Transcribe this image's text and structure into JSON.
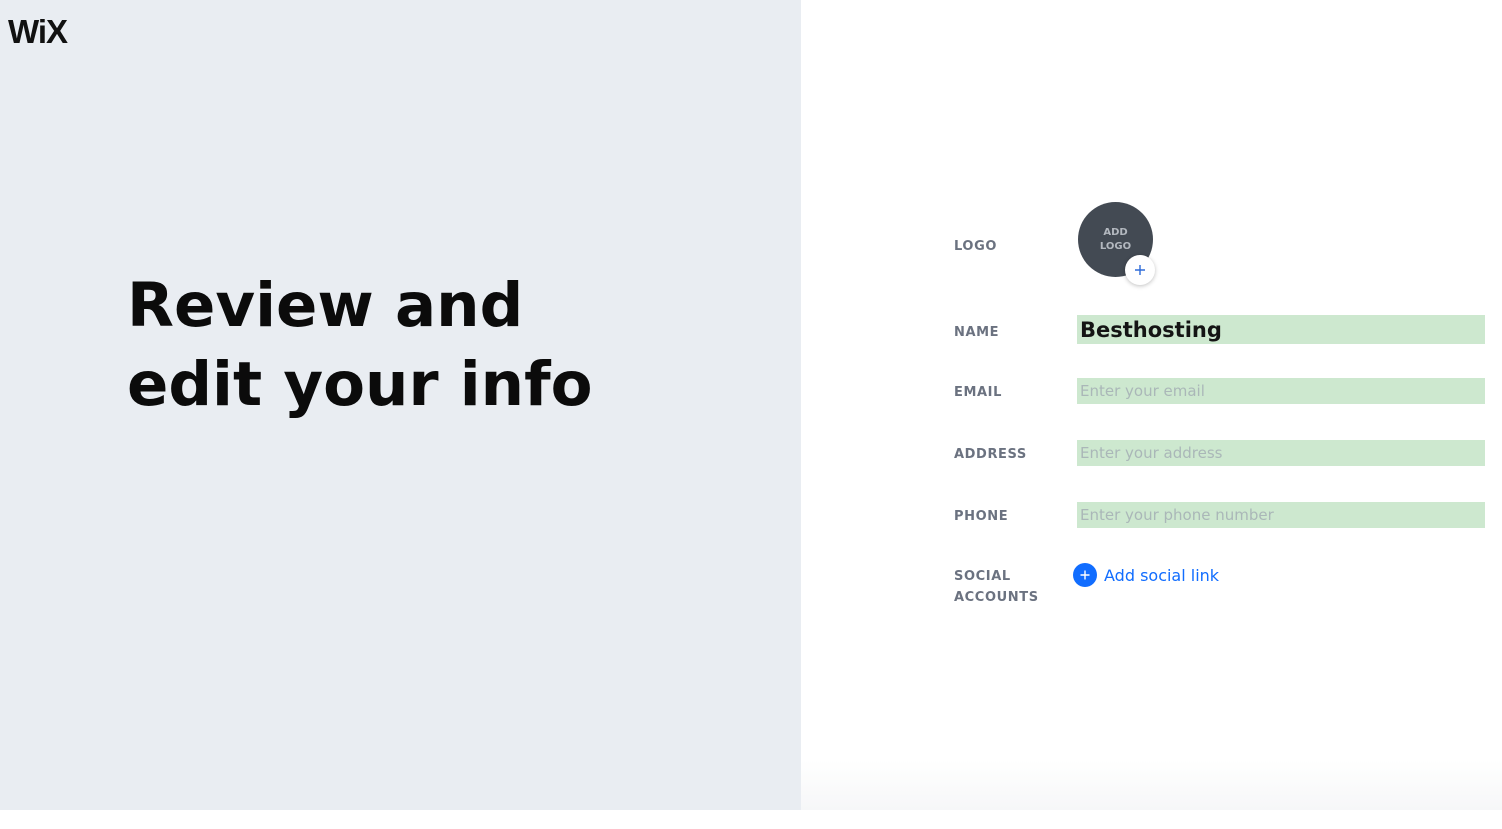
{
  "brand": {
    "logo_text": "WiX"
  },
  "hero": {
    "title_line1": "Review and",
    "title_line2": "edit your info"
  },
  "form": {
    "logo": {
      "label": "LOGO",
      "button_text": "ADD LOGO",
      "plus_icon": "plus-icon"
    },
    "name": {
      "label": "NAME",
      "value": "Besthosting"
    },
    "email": {
      "label": "EMAIL",
      "placeholder": "Enter your email"
    },
    "address": {
      "label": "ADDRESS",
      "placeholder": "Enter your address"
    },
    "phone": {
      "label": "PHONE",
      "placeholder": "Enter your phone number"
    },
    "social": {
      "label": "SOCIAL ACCOUNTS",
      "add_link_label": "Add social link",
      "add_icon": "plus-circle-icon"
    }
  },
  "colors": {
    "left_panel_bg": "#e9edf2",
    "input_highlight": "#cde8cf",
    "accent_blue": "#116dff",
    "logo_circle": "#434a53",
    "label_gray": "#6b7280"
  }
}
